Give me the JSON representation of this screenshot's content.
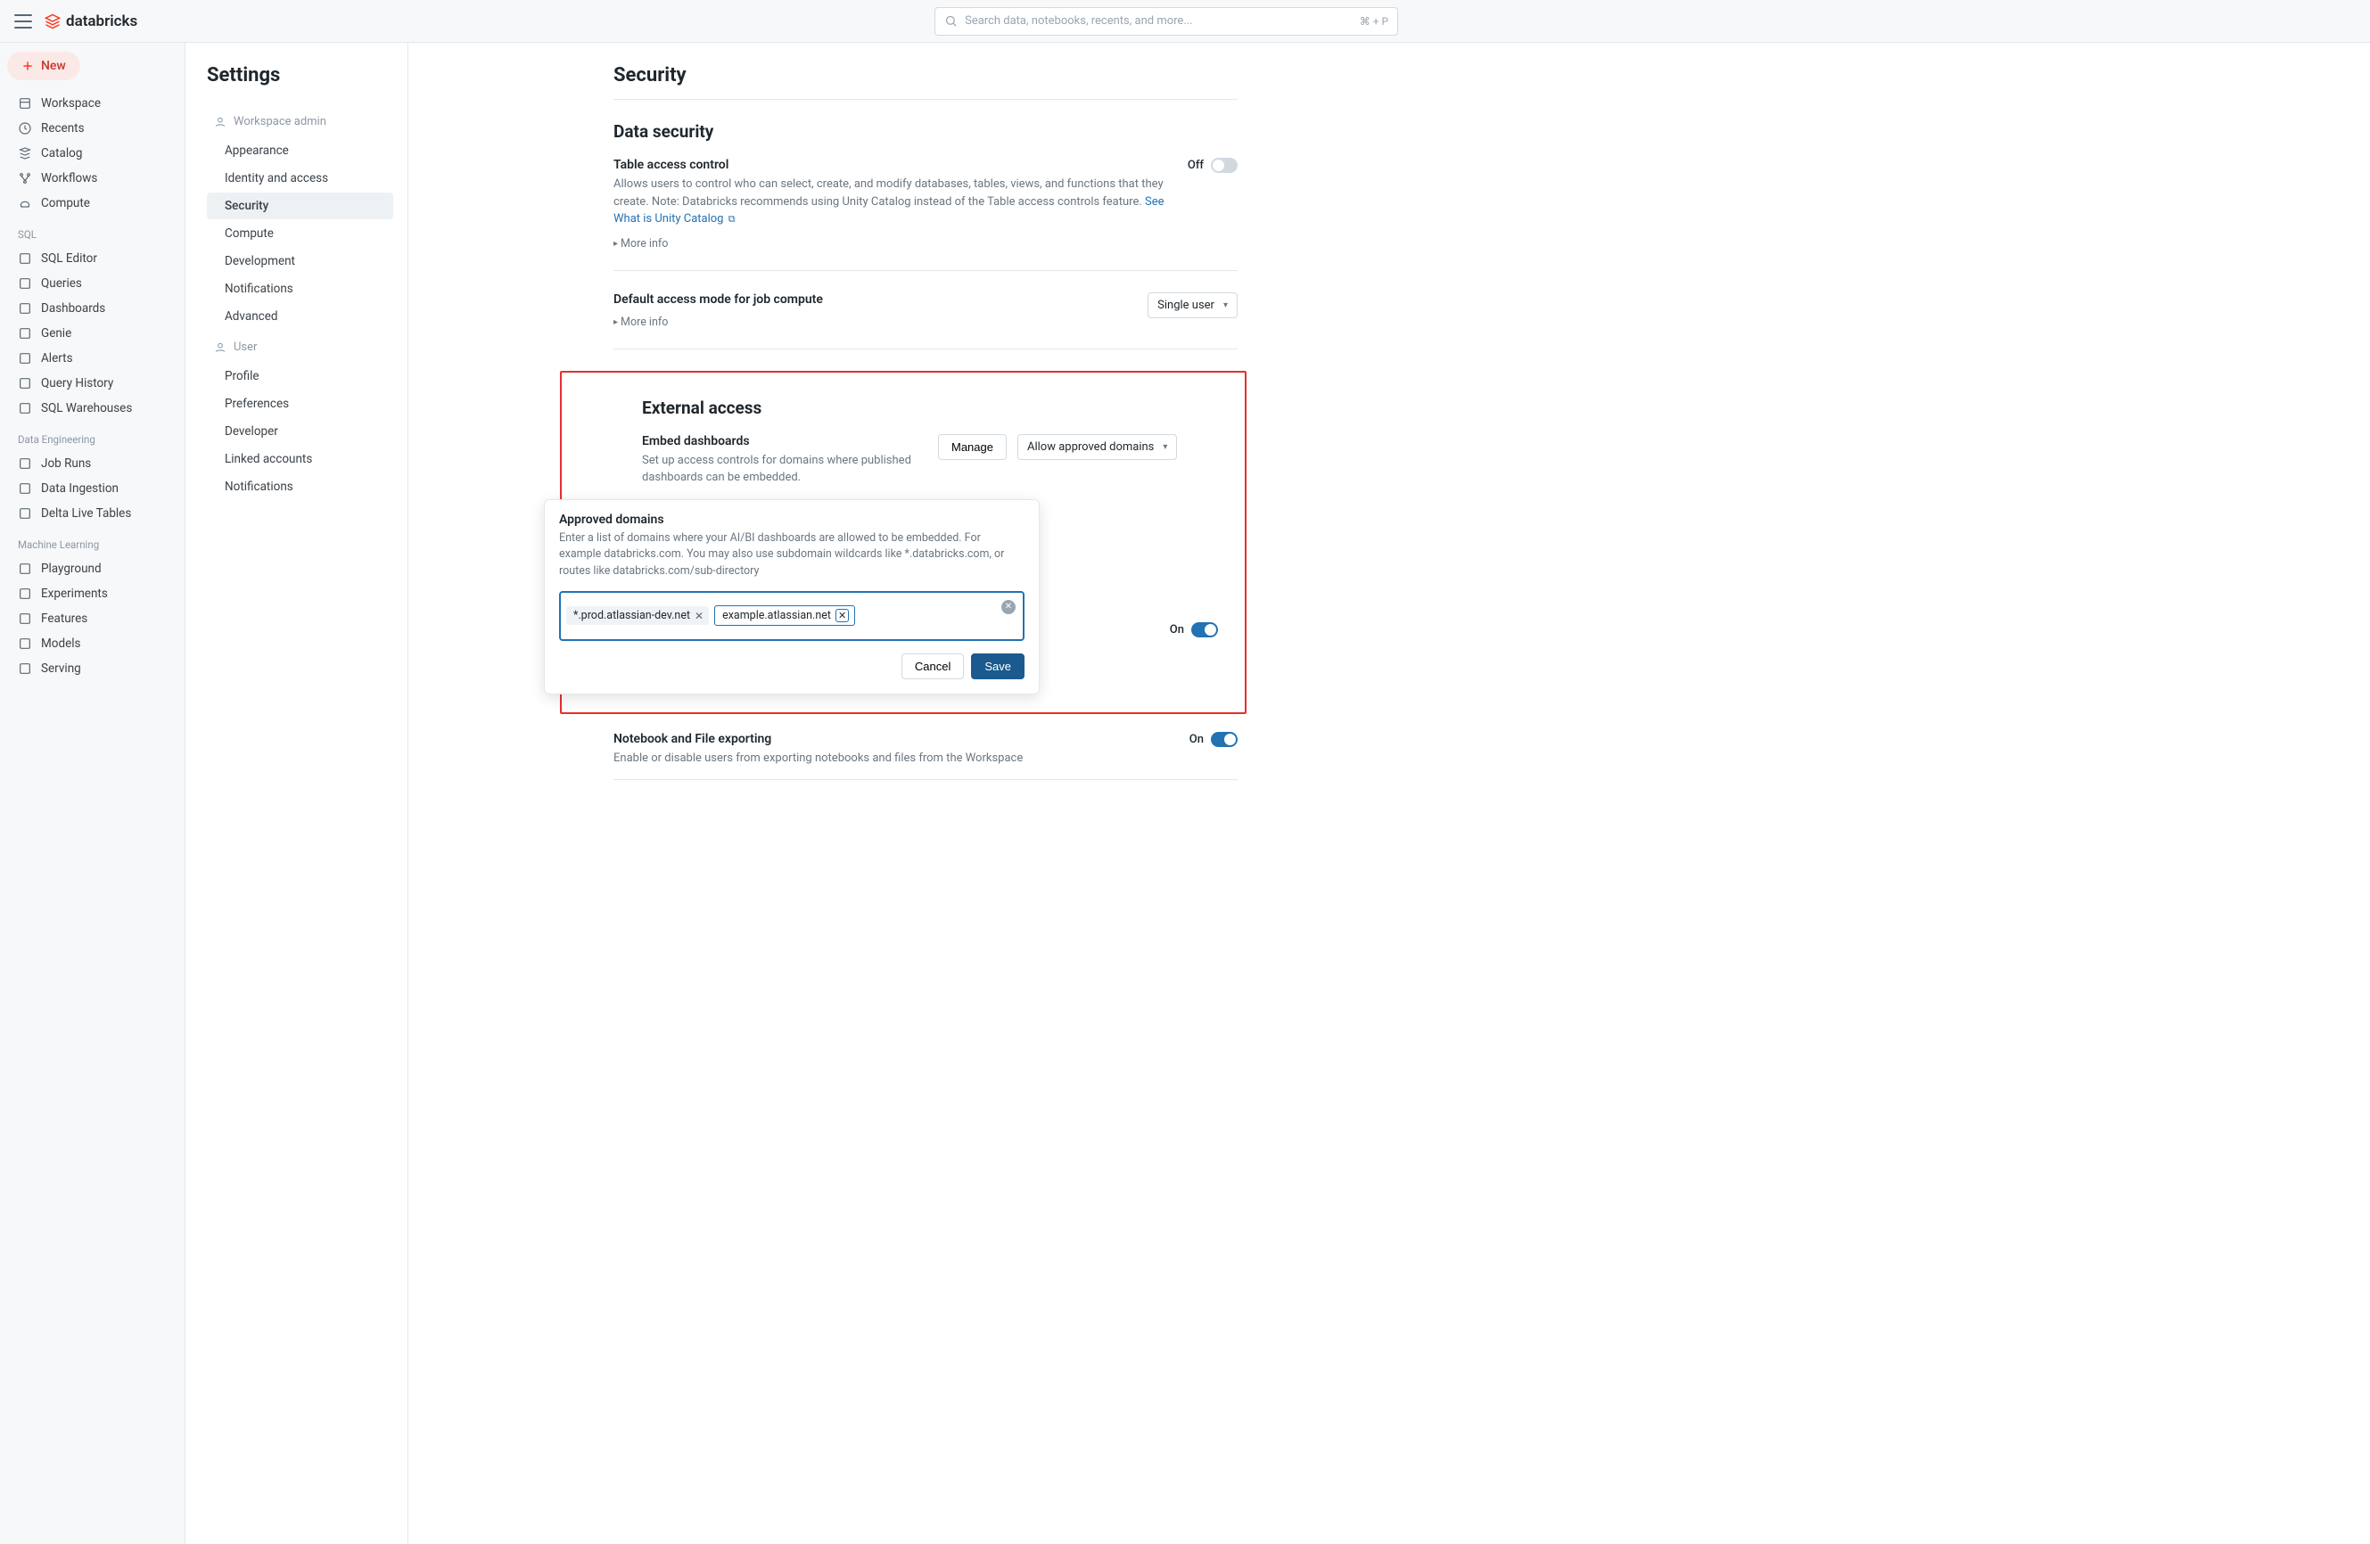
{
  "header": {
    "brand": "databricks",
    "search_placeholder": "Search data, notebooks, recents, and more...",
    "search_kbd": "⌘ + P"
  },
  "sidebar": {
    "new_label": "New",
    "primary": [
      {
        "label": "Workspace"
      },
      {
        "label": "Recents"
      },
      {
        "label": "Catalog"
      },
      {
        "label": "Workflows"
      },
      {
        "label": "Compute"
      }
    ],
    "sections": [
      {
        "heading": "SQL",
        "items": [
          {
            "label": "SQL Editor"
          },
          {
            "label": "Queries"
          },
          {
            "label": "Dashboards"
          },
          {
            "label": "Genie"
          },
          {
            "label": "Alerts"
          },
          {
            "label": "Query History"
          },
          {
            "label": "SQL Warehouses"
          }
        ]
      },
      {
        "heading": "Data Engineering",
        "items": [
          {
            "label": "Job Runs"
          },
          {
            "label": "Data Ingestion"
          },
          {
            "label": "Delta Live Tables"
          }
        ]
      },
      {
        "heading": "Machine Learning",
        "items": [
          {
            "label": "Playground"
          },
          {
            "label": "Experiments"
          },
          {
            "label": "Features"
          },
          {
            "label": "Models"
          },
          {
            "label": "Serving"
          }
        ]
      }
    ]
  },
  "settings_nav": {
    "title": "Settings",
    "groups": [
      {
        "heading": "Workspace admin",
        "items": [
          {
            "label": "Appearance"
          },
          {
            "label": "Identity and access"
          },
          {
            "label": "Security",
            "active": true
          },
          {
            "label": "Compute"
          },
          {
            "label": "Development"
          },
          {
            "label": "Notifications"
          },
          {
            "label": "Advanced"
          }
        ]
      },
      {
        "heading": "User",
        "items": [
          {
            "label": "Profile"
          },
          {
            "label": "Preferences"
          },
          {
            "label": "Developer"
          },
          {
            "label": "Linked accounts"
          },
          {
            "label": "Notifications"
          }
        ]
      }
    ]
  },
  "main": {
    "page_title": "Security",
    "data_security": {
      "heading": "Data security",
      "tac_label": "Table access control",
      "tac_desc": "Allows users to control who can select, create, and modify databases, tables, views, and functions that they create. Note: Databricks recommends using Unity Catalog instead of the Table access controls feature. ",
      "tac_link": "See What is Unity Catalog",
      "tac_state": "Off",
      "more_info": "More info",
      "default_mode_label": "Default access mode for job compute",
      "default_mode_value": "Single user"
    },
    "external": {
      "heading": "External access",
      "embed_label": "Embed dashboards",
      "embed_desc": "Set up access controls for domains where published dashboards can be embedded.",
      "manage": "Manage",
      "allow": "Allow approved domains",
      "popover_title": "Approved domains",
      "popover_desc": "Enter a list of domains where your AI/BI dashboards are allowed to be embedded. For example databricks.com. You may also use subdomain wildcards like *.databricks.com, or routes like databricks.com/sub-directory",
      "tags": [
        "*.prod.atlassian-dev.net",
        "example.atlassian.net"
      ],
      "cancel": "Cancel",
      "save": "Save",
      "on_label": "On"
    },
    "notebook": {
      "label": "Notebook and File exporting",
      "desc": "Enable or disable users from exporting notebooks and files from the Workspace",
      "state": "On"
    }
  }
}
